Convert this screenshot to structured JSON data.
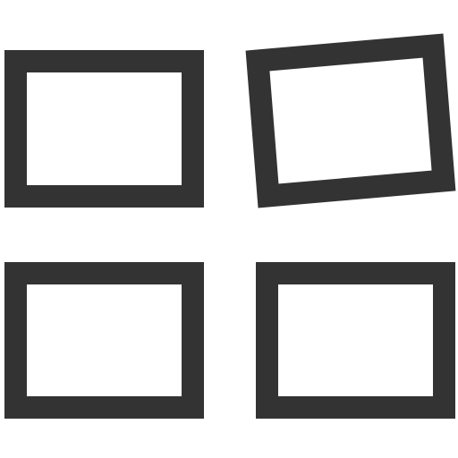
{
  "icon": {
    "name": "widgets-icon",
    "color": "#333333",
    "background": "#ffffff",
    "tiles": [
      {
        "name": "tile-top-left",
        "tilted": false
      },
      {
        "name": "tile-top-right",
        "tilted": true
      },
      {
        "name": "tile-bottom-left",
        "tilted": false
      },
      {
        "name": "tile-bottom-right",
        "tilted": false
      }
    ]
  }
}
